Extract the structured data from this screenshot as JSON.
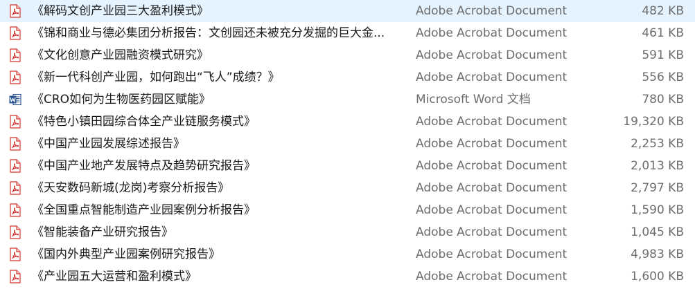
{
  "files": [
    {
      "name": "《解码文创产业园三大盈利模式》",
      "type": "Adobe Acrobat Document",
      "size": "482 KB",
      "icon": "pdf-icon"
    },
    {
      "name": "《锦和商业与德必集团分析报告：文创园还未被充分发掘的巨大金...",
      "type": "Adobe Acrobat Document",
      "size": "461 KB",
      "icon": "pdf-icon"
    },
    {
      "name": "《文化创意产业园融资模式研究》",
      "type": "Adobe Acrobat Document",
      "size": "591 KB",
      "icon": "pdf-icon"
    },
    {
      "name": "《新一代科创产业园，如何跑出“飞人”成绩？》",
      "type": "Adobe Acrobat Document",
      "size": "556 KB",
      "icon": "pdf-icon"
    },
    {
      "name": "《CRO如何为生物医药园区赋能》",
      "type": "Microsoft Word 文档",
      "size": "780 KB",
      "icon": "word-icon"
    },
    {
      "name": "《特色小镇田园综合体全产业链服务模式》",
      "type": "Adobe Acrobat Document",
      "size": "19,320 KB",
      "icon": "pdf-icon"
    },
    {
      "name": "《中国产业园发展综述报告》",
      "type": "Adobe Acrobat Document",
      "size": "2,253 KB",
      "icon": "pdf-icon"
    },
    {
      "name": "《中国产业地产发展特点及趋势研究报告》",
      "type": "Adobe Acrobat Document",
      "size": "2,013 KB",
      "icon": "pdf-icon"
    },
    {
      "name": "《天安数码新城(龙岗)考察分析报告》",
      "type": "Adobe Acrobat Document",
      "size": "2,797 KB",
      "icon": "pdf-icon"
    },
    {
      "name": "《全国重点智能制造产业园案例分析报告》",
      "type": "Adobe Acrobat Document",
      "size": "1,590 KB",
      "icon": "pdf-icon"
    },
    {
      "name": "《智能装备产业研究报告》",
      "type": "Adobe Acrobat Document",
      "size": "1,045 KB",
      "icon": "pdf-icon"
    },
    {
      "name": "《国内外典型产业园案例研究报告》",
      "type": "Adobe Acrobat Document",
      "size": "4,983 KB",
      "icon": "pdf-icon"
    },
    {
      "name": "《产业园五大运营和盈利模式》",
      "type": "Adobe Acrobat Document",
      "size": "1,600 KB",
      "icon": "pdf-icon"
    }
  ],
  "colors": {
    "pdf_icon": "#d7312c",
    "word_icon": "#2b5797",
    "secondary_text": "#6d6d6d"
  }
}
